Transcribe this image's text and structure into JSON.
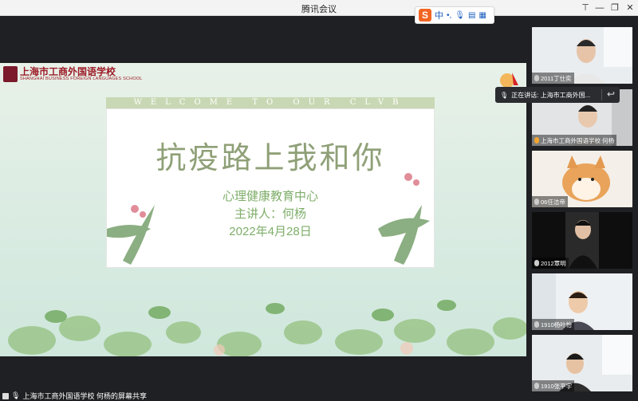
{
  "window": {
    "title": "腾讯会议"
  },
  "ime": {
    "logo": "S",
    "label": "中",
    "icons": [
      "dot-icon",
      "mic-icon",
      "keyboard-icon",
      "apps-icon"
    ]
  },
  "share": {
    "school_cn": "上海市工商外国语学校",
    "school_en": "SHANGHAI BUSINESS FOREIGN LANGUAGES SCHOOL",
    "banner": "WELCOME TO OUR CLVB",
    "slide": {
      "title": "抗疫路上我和你",
      "line1": "心理健康教育中心",
      "line2": "主讲人：何杨",
      "line3": "2022年4月28日"
    }
  },
  "speaking": {
    "label": "正在讲话: 上海市工商外国..."
  },
  "participants": [
    {
      "name": "2011丁仕奕"
    },
    {
      "name": "上海市工商外国语学校 何杨"
    },
    {
      "name": "06任洁帝"
    },
    {
      "name": "2012覃明"
    },
    {
      "name": "1910杨叶怡"
    },
    {
      "name": "1910张平宇"
    }
  ],
  "status": {
    "text": "上海市工商外国语学校 何杨的屏幕共享"
  },
  "colors": {
    "accent": "#9c1a26",
    "slide_title": "#8fa077",
    "slide_text": "#7fae6a"
  }
}
